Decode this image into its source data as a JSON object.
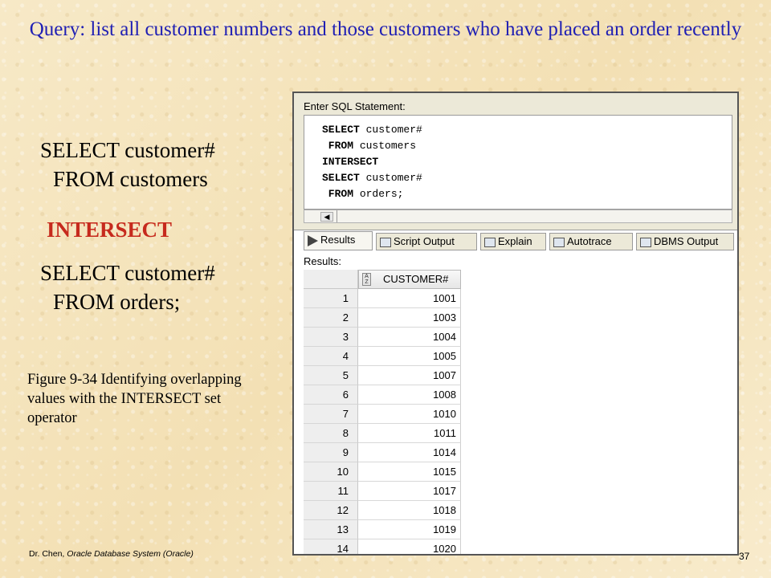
{
  "slide": {
    "title": "Query: list all customer numbers and those customers who have placed an order recently",
    "sql_left": {
      "line1": "SELECT customer#",
      "line2": "FROM customers",
      "keyword": "INTERSECT",
      "line3": "SELECT customer#",
      "line4": "FROM orders;"
    },
    "caption": "Figure 9-34  Identifying overlapping values with the INTERSECT set operator",
    "footer_author": "Dr. Chen,",
    "footer_course": "Oracle Database System (Oracle)",
    "page_number": "37",
    "title_color": "#1f1fb4",
    "keyword_color": "#c62a1d"
  },
  "screenshot": {
    "enter_label": "Enter SQL Statement:",
    "code_lines": [
      {
        "kw": "SELECT",
        "rest": " customer#"
      },
      {
        "kw": " FROM",
        "rest": " customers"
      },
      {
        "kw": "INTERSECT",
        "rest": ""
      },
      {
        "kw": "SELECT",
        "rest": " customer#"
      },
      {
        "kw": " FROM",
        "rest": " orders;"
      }
    ],
    "tabs": [
      {
        "label": "Results",
        "icon": "play-icon",
        "active": true
      },
      {
        "label": "Script Output",
        "icon": "script-icon",
        "active": false
      },
      {
        "label": "Explain",
        "icon": "explain-icon",
        "active": false
      },
      {
        "label": "Autotrace",
        "icon": "autotrace-icon",
        "active": false
      },
      {
        "label": "DBMS Output",
        "icon": "dbms-icon",
        "active": false
      }
    ],
    "results_label": "Results:",
    "column_header": "CUSTOMER#",
    "rows": [
      {
        "n": "1",
        "v": "1001"
      },
      {
        "n": "2",
        "v": "1003"
      },
      {
        "n": "3",
        "v": "1004"
      },
      {
        "n": "4",
        "v": "1005"
      },
      {
        "n": "5",
        "v": "1007"
      },
      {
        "n": "6",
        "v": "1008"
      },
      {
        "n": "7",
        "v": "1010"
      },
      {
        "n": "8",
        "v": "1011"
      },
      {
        "n": "9",
        "v": "1014"
      },
      {
        "n": "10",
        "v": "1015"
      },
      {
        "n": "11",
        "v": "1017"
      },
      {
        "n": "12",
        "v": "1018"
      },
      {
        "n": "13",
        "v": "1019"
      },
      {
        "n": "14",
        "v": "1020"
      }
    ]
  }
}
